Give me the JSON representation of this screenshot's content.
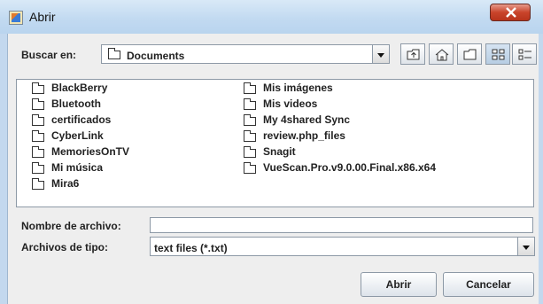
{
  "window": {
    "title": "Abrir",
    "close_icon": "close-icon"
  },
  "lookin": {
    "label": "Buscar en:",
    "value": "Documents"
  },
  "toolbar": {
    "buttons": [
      {
        "name": "up-one-level",
        "icon": "up-folder-icon"
      },
      {
        "name": "home",
        "icon": "home-icon"
      },
      {
        "name": "new-folder",
        "icon": "new-folder-icon"
      },
      {
        "name": "list-view",
        "icon": "list-view-icon"
      },
      {
        "name": "details-view",
        "icon": "details-view-icon"
      }
    ]
  },
  "files": {
    "column1": [
      "BlackBerry",
      "Bluetooth",
      "certificados",
      "CyberLink",
      "MemoriesOnTV",
      "Mi música",
      "Mira6"
    ],
    "column2": [
      "Mis imágenes",
      "Mis videos",
      "My 4shared Sync",
      "review.php_files",
      "Snagit",
      "VueScan.Pro.v9.0.00.Final.x86.x64"
    ]
  },
  "filename": {
    "label": "Nombre de archivo:",
    "value": ""
  },
  "filetype": {
    "label": "Archivos de tipo:",
    "value": "text files (*.txt)"
  },
  "buttons": {
    "open": "Abrir",
    "cancel": "Cancelar"
  }
}
